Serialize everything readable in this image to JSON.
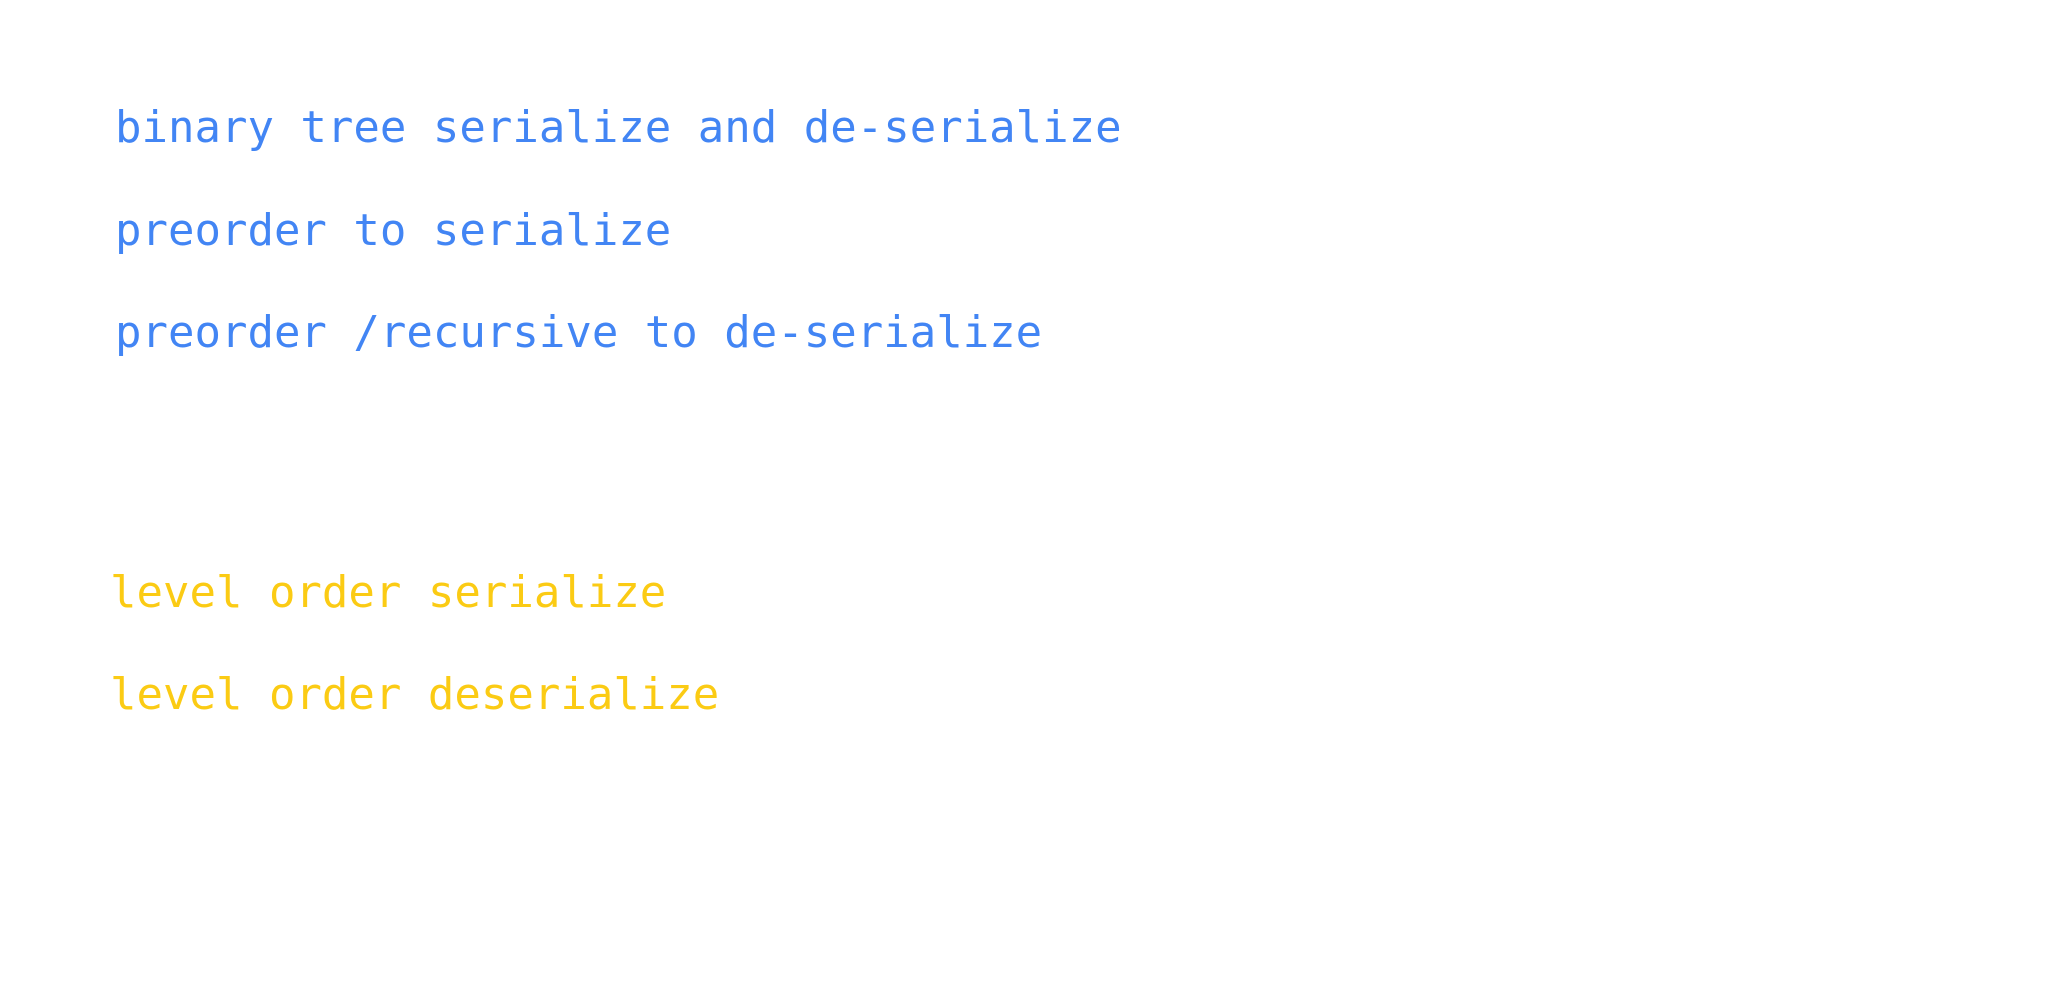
{
  "notes": {
    "blue_lines": [
      "binary tree serialize and de-serialize",
      "preorder to serialize",
      "preorder /recursive to de-serialize"
    ],
    "yellow_lines": [
      "level order serialize",
      "level order deserialize"
    ]
  },
  "colors": {
    "blue": "#4285F4",
    "yellow": "#FBCB14",
    "background": "#FFFFFF"
  }
}
